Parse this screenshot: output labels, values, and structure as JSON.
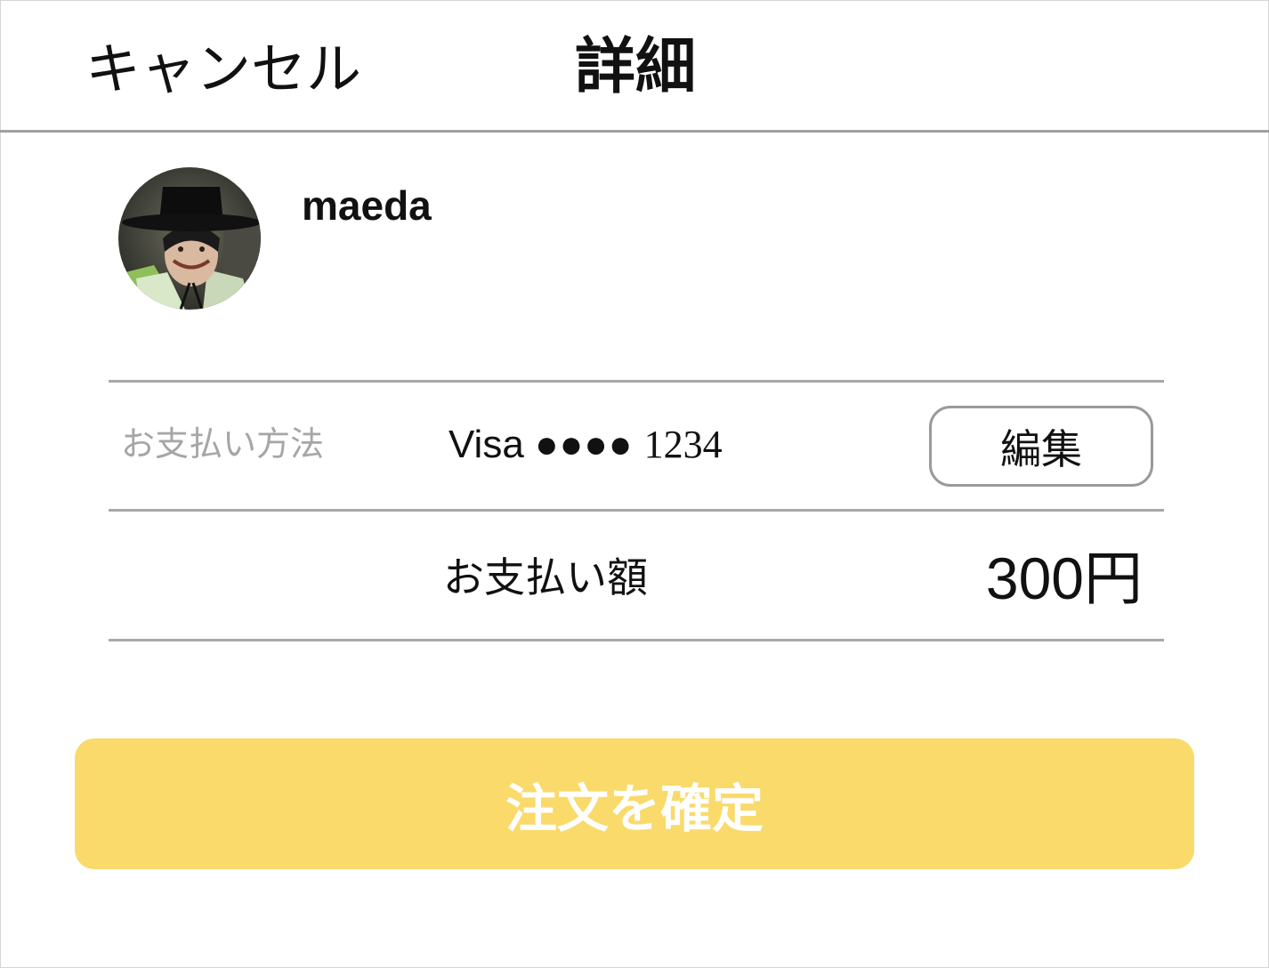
{
  "header": {
    "cancel_label": "キャンセル",
    "title": "詳細"
  },
  "profile": {
    "username": "maeda"
  },
  "payment": {
    "method_label": "お支払い方法",
    "card_brand": "Visa",
    "card_mask": "●●●●",
    "card_last4": "1234",
    "edit_label": "編集"
  },
  "amount": {
    "label": "お支払い額",
    "value": "300",
    "currency": "円"
  },
  "confirm": {
    "label": "注文を確定"
  },
  "colors": {
    "accent": "#f9da6b",
    "divider": "#a8a8a8",
    "muted_text": "#a6a6a6"
  }
}
